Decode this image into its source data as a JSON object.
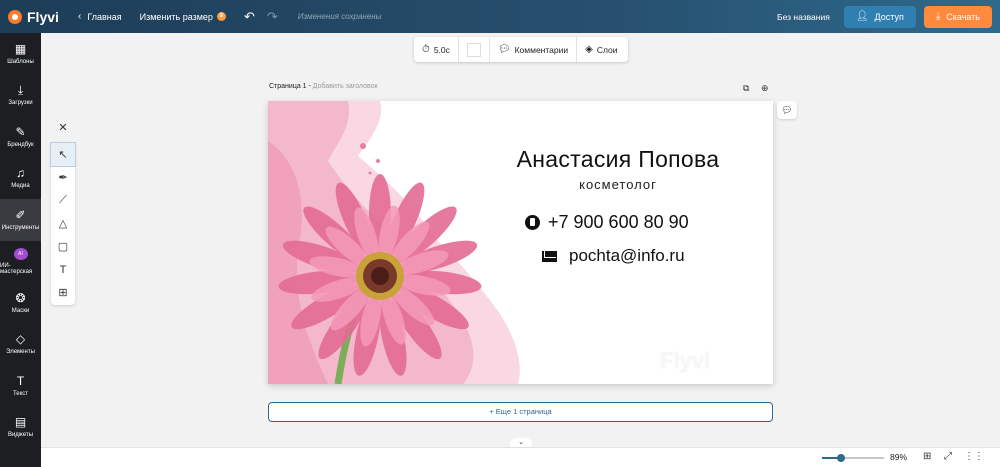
{
  "app": {
    "logo_text": "Flyvi",
    "home_label": "Главная",
    "resize_label": "Изменить размер",
    "save_status": "Изменения сохранены",
    "doc_title": "Без названия",
    "access_label": "Доступ",
    "download_label": "Скачать"
  },
  "sidebar": {
    "items": [
      {
        "label": "Шаблоны",
        "icon": "layout-icon"
      },
      {
        "label": "Загрузки",
        "icon": "upload-icon"
      },
      {
        "label": "Брендбук",
        "icon": "brush-icon"
      },
      {
        "label": "Медиа",
        "icon": "media-icon"
      },
      {
        "label": "Инструменты",
        "icon": "pencil-icon"
      },
      {
        "label": "ИИ-мастерская",
        "icon": "ai-icon",
        "badge": "AI"
      },
      {
        "label": "Маски",
        "icon": "masks-icon"
      },
      {
        "label": "Элементы",
        "icon": "shapes-icon"
      },
      {
        "label": "Текст",
        "icon": "text-icon"
      },
      {
        "label": "Виджеты",
        "icon": "widgets-icon"
      }
    ],
    "active_index": 4
  },
  "canvas_toolbar": {
    "duration": "5.0с",
    "comments_label": "Комментарии",
    "layers_label": "Слои"
  },
  "page": {
    "title": "Страница 1 -",
    "subtitle_placeholder": "Добавить заголовок",
    "add_page_label": "+ Еще 1 страница"
  },
  "card": {
    "name": "Анастасия Попова",
    "role": "косметолог",
    "phone": "+7 900 600 80 90",
    "email": "pochta@info.ru",
    "watermark": "Flyvi"
  },
  "footer": {
    "zoom": "89%",
    "zoom_fraction": 0.3
  },
  "colors": {
    "accent": "#2e6a8c",
    "download": "#ff8a3d",
    "sidebar_bg": "#1d1e22"
  }
}
